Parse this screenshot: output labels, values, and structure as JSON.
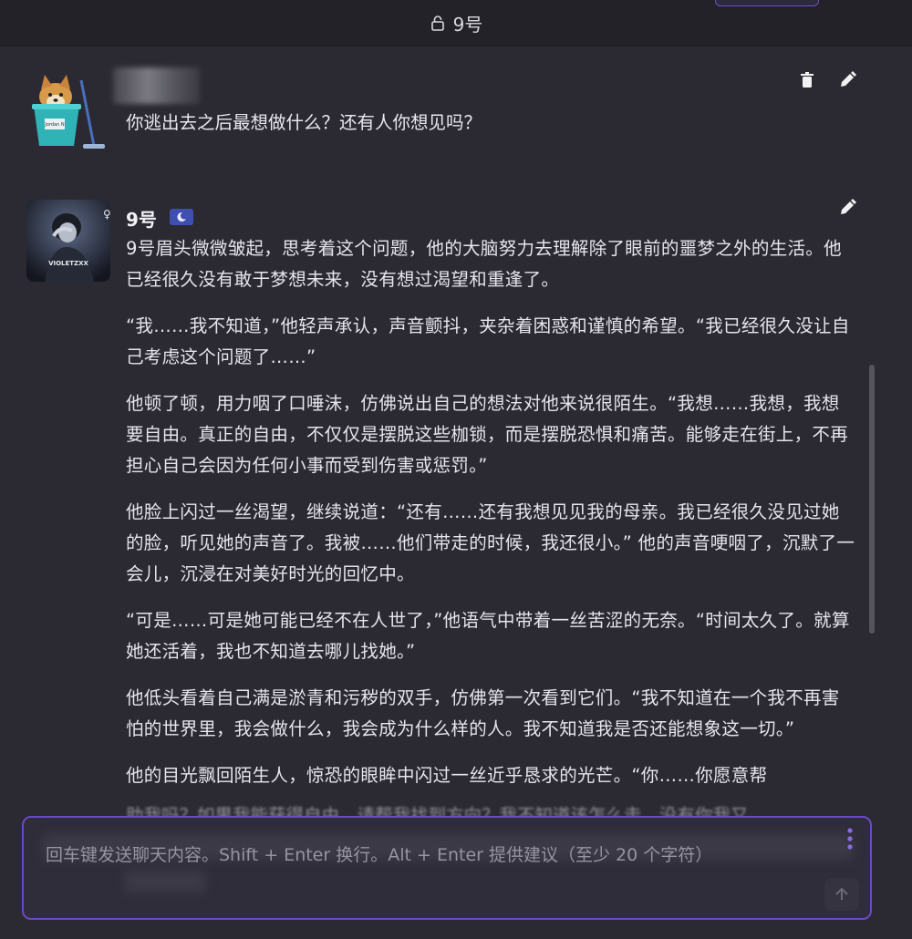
{
  "header": {
    "title": "9号",
    "lock_icon": "lock-icon"
  },
  "user_message": {
    "text": "你逃出去之后最想做什么？还有人你想见吗？",
    "avatar_label": "Jordan N"
  },
  "bot_message": {
    "name": "9号",
    "paragraphs": [
      "9号眉头微微皱起，思考着这个问题，他的大脑努力去理解除了眼前的噩梦之外的生活。他已经很久没有敢于梦想未来，没有想过渴望和重逢了。",
      "“我……我不知道，”他轻声承认，声音颤抖，夹杂着困惑和谨慎的希望。“我已经很久没让自己考虑这个问题了……”",
      "他顿了顿，用力咽了口唾沫，仿佛说出自己的想法对他来说很陌生。“我想……我想，我想要自由。真正的自由，不仅仅是摆脱这些枷锁，而是摆脱恐惧和痛苦。能够走在街上，不再担心自己会因为任何小事而受到伤害或惩罚。”",
      "他脸上闪过一丝渴望，继续说道：“还有……还有我想见见我的母亲。我已经很久没见过她的脸，听见她的声音了。我被……他们带走的时候，我还很小。” 他的声音哽咽了，沉默了一会儿，沉浸在对美好时光的回忆中。",
      "“可是……可是她可能已经不在人世了，”他语气中带着一丝苦涩的无奈。“时间太久了。就算她还活着，我也不知道去哪儿找她。”",
      "他低头看着自己满是淤青和污秽的双手，仿佛第一次看到它们。“我不知道在一个我不再害怕的世界里，我会做什么，我会成为什么样的人。我不知道我是否还能想象这一切。”",
      "他的目光飘回陌生人，惊恐的眼眸中闪过一丝近乎恳求的光芒。“你……你愿意帮"
    ],
    "cut_line": "助我吗？如果我能获得自由，请帮我找到方向？我不知道该怎么走，没有你我又",
    "avatar_label": "VIOLETZXX"
  },
  "composer": {
    "placeholder": "回车键发送聊天内容。Shift + Enter 换行。Alt + Enter 提供建议（至少 20 个字符）"
  },
  "colors": {
    "background": "#2b2a33",
    "accent": "#6a49c4",
    "badge": "#3f4fb0"
  }
}
